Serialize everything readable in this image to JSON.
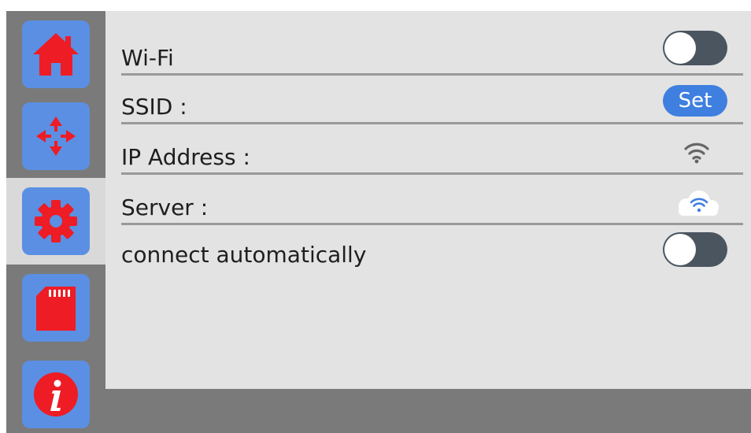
{
  "sidebar": {
    "items": [
      {
        "name": "home",
        "icon": "home-icon",
        "selected": false
      },
      {
        "name": "move",
        "icon": "move-arrows-icon",
        "selected": false
      },
      {
        "name": "settings",
        "icon": "gear-icon",
        "selected": true
      },
      {
        "name": "sd-card",
        "icon": "sd-card-icon",
        "selected": false
      },
      {
        "name": "info",
        "icon": "info-icon",
        "selected": false
      }
    ],
    "button_color": "#5b8fe3",
    "icon_color": "#ee1c24"
  },
  "settings": {
    "wifi": {
      "label": "Wi-Fi",
      "enabled": false
    },
    "ssid": {
      "label": "SSID :",
      "button_label": "Set"
    },
    "ip": {
      "label": "IP Address :",
      "icon": "wifi-signal-icon"
    },
    "server": {
      "label": "Server :",
      "icon": "cloud-wifi-icon"
    },
    "auto_connect": {
      "label": "connect automatically",
      "enabled": false
    }
  },
  "colors": {
    "accent": "#3f7fe0",
    "toggle_off": "#4b5560",
    "content_bg": "#e3e3e3",
    "frame": "#7a7a7a"
  }
}
